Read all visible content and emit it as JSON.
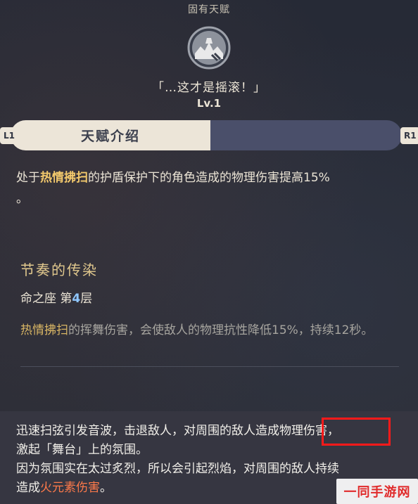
{
  "header": {
    "section_label": "固有天赋",
    "talent_name": "「…这才是摇滚！」",
    "level": "Lv.1",
    "emblem_icon": "rock-hand-emblem-icon"
  },
  "tabs": {
    "left_button": "L1",
    "right_button": "R1",
    "active_label": "天赋介绍"
  },
  "description": {
    "prefix": "处于",
    "highlight": "热情拂扫",
    "suffix": "的护盾保护下的角色造成的物理伤害提高15%",
    "end": "。"
  },
  "constellation": {
    "title": "节奏的传染",
    "layer_prefix": "命之座 第",
    "layer_number": "4",
    "layer_suffix": "层",
    "desc_highlight": "热情拂扫",
    "desc_rest": "的挥舞伤害，会使敌人的物理抗性降低15%，持续12秒。"
  },
  "bottom": {
    "line1_a": "迅速扫弦引发音波，击退敌人，对周围的敌人造成",
    "line1_b": "物理伤害",
    "line1_c": "，",
    "line2": "激起「舞台」上的氛围。",
    "line3": "因为氛围实在太过炙烈，所以会引起烈焰，对周围的敌人持续",
    "line4_a": "造成",
    "line4_b": "火元素伤害",
    "line4_c": "。"
  },
  "watermark": {
    "text": "一同手游网"
  },
  "colors": {
    "highlight_gold": "#f3c96c",
    "fire_element": "#ff7a4a",
    "annotation_red": "#ff1a1a",
    "constellation_number": "#8fc7ff"
  }
}
